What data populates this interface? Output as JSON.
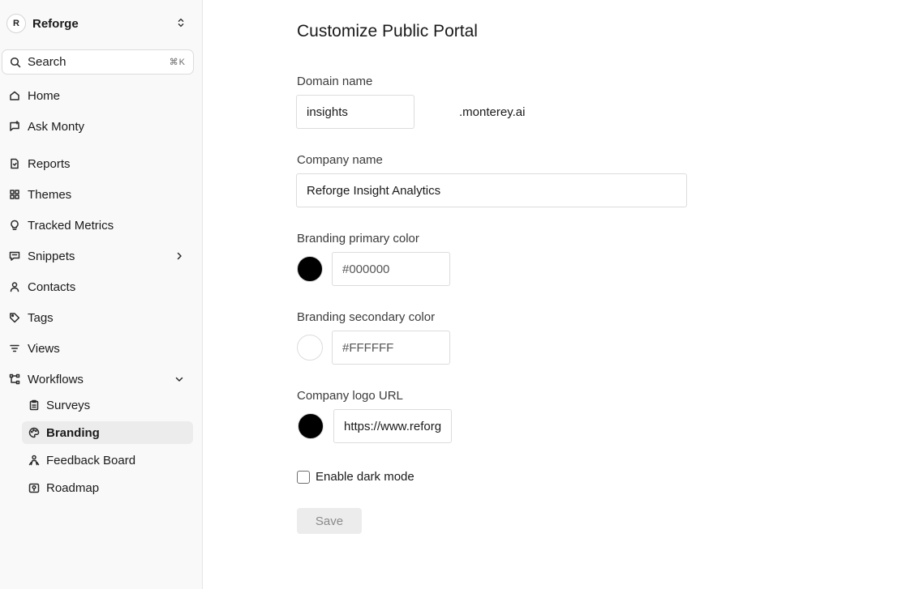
{
  "workspace": {
    "initial": "R",
    "name": "Reforge"
  },
  "search": {
    "label": "Search",
    "shortcut": "⌘K"
  },
  "sidebar": {
    "items": [
      {
        "label": "Home",
        "icon": "home-icon"
      },
      {
        "label": "Ask Monty",
        "icon": "chat-icon"
      },
      {
        "label": "Reports",
        "icon": "report-icon"
      },
      {
        "label": "Themes",
        "icon": "grid-icon"
      },
      {
        "label": "Tracked Metrics",
        "icon": "bulb-icon"
      },
      {
        "label": "Snippets",
        "icon": "snippet-icon"
      },
      {
        "label": "Contacts",
        "icon": "person-icon"
      },
      {
        "label": "Tags",
        "icon": "tag-icon"
      },
      {
        "label": "Views",
        "icon": "filter-icon"
      },
      {
        "label": "Workflows",
        "icon": "workflow-icon"
      }
    ],
    "workflow_children": [
      {
        "label": "Surveys",
        "icon": "clipboard-icon"
      },
      {
        "label": "Branding",
        "icon": "palette-icon",
        "active": true
      },
      {
        "label": "Feedback Board",
        "icon": "people-icon"
      },
      {
        "label": "Roadmap",
        "icon": "map-icon"
      }
    ]
  },
  "main": {
    "title": "Customize Public Portal",
    "domain": {
      "label": "Domain name",
      "value": "insights",
      "suffix": ".monterey.ai"
    },
    "company": {
      "label": "Company name",
      "value": "Reforge Insight Analytics"
    },
    "primary_color": {
      "label": "Branding primary color",
      "value": "#000000",
      "swatch": "#000000"
    },
    "secondary_color": {
      "label": "Branding secondary color",
      "value": "#FFFFFF",
      "swatch": "#FFFFFF"
    },
    "logo": {
      "label": "Company logo URL",
      "value": "https://www.reforge.com/logo.png"
    },
    "dark_mode": {
      "label": "Enable dark mode",
      "checked": false
    },
    "save_label": "Save"
  }
}
